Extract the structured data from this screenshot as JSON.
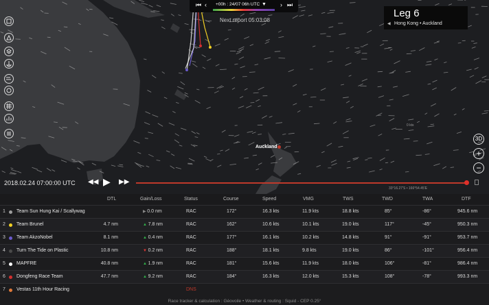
{
  "topbar": {
    "timestamp": "+00h : 24/07 06h UTC"
  },
  "next_report": "Next report 05:03:08",
  "leg": {
    "title": "Leg 6",
    "route": "Hong Kong • Auckland"
  },
  "map": {
    "city_label": "Auckland",
    "speed_readout": "0 kts",
    "coords_readout": "33°16.27'S • 166°54.45'E"
  },
  "right_controls": {
    "view3d": "3D",
    "zoom_in": "+",
    "zoom_out": "−"
  },
  "playback": {
    "date": "2018.02.24 07:00:00 UTC"
  },
  "colors": {
    "timeline": "#c0392b",
    "gain": "#32b04a",
    "loss": "#e53935"
  },
  "table": {
    "headers": {
      "dtl": "DTL",
      "gainloss": "Gain/Loss",
      "status": "Status",
      "course": "Course",
      "speed": "Speed",
      "vmg": "VMG",
      "tws": "TWS",
      "twd": "TWD",
      "twa": "TWA",
      "dtf": "DTF"
    },
    "rows": [
      {
        "rank": "1",
        "team": "Team Sun Hung Kai / Scallywag",
        "color": "#9e9e9e",
        "dtl": "",
        "gain_dir": "flat",
        "gain": "0.0 nm",
        "status": "RAC",
        "course": "172°",
        "speed": "16.3 kts",
        "vmg": "11.9 kts",
        "tws": "18.8 kts",
        "twd": "85°",
        "twa": "-86°",
        "dtf": "945.6 nm"
      },
      {
        "rank": "2",
        "team": "Team Brunel",
        "color": "#f2d024",
        "dtl": "4.7 nm",
        "gain_dir": "up",
        "gain": "7.8 nm",
        "status": "RAC",
        "course": "162°",
        "speed": "10.6 kts",
        "vmg": "10.1 kts",
        "tws": "19.0 kts",
        "twd": "117°",
        "twa": "-45°",
        "dtf": "950.3 nm"
      },
      {
        "rank": "3",
        "team": "Team AkzoNobel",
        "color": "#6a5acd",
        "dtl": "8.1 nm",
        "gain_dir": "up",
        "gain": "0.4 nm",
        "status": "RAC",
        "course": "177°",
        "speed": "16.1 kts",
        "vmg": "10.2 kts",
        "tws": "14.8 kts",
        "twd": "91°",
        "twa": "-91°",
        "dtf": "953.7 nm"
      },
      {
        "rank": "4",
        "team": "Turn The Tide on Plastic",
        "color": "#4a4a4a",
        "dtl": "10.8 nm",
        "gain_dir": "down",
        "gain": "0.2 nm",
        "status": "RAC",
        "course": "188°",
        "speed": "18.1 kts",
        "vmg": "9.8 kts",
        "tws": "19.0 kts",
        "twd": "86°",
        "twa": "-101°",
        "dtf": "956.4 nm"
      },
      {
        "rank": "5",
        "team": "MAPFRE",
        "color": "#ffffff",
        "dtl": "40.8 nm",
        "gain_dir": "up",
        "gain": "1.9 nm",
        "status": "RAC",
        "course": "181°",
        "speed": "15.6 kts",
        "vmg": "11.9 kts",
        "tws": "18.0 kts",
        "twd": "106°",
        "twa": "-81°",
        "dtf": "986.4 nm"
      },
      {
        "rank": "6",
        "team": "Dongfeng Race Team",
        "color": "#d32f2f",
        "dtl": "47.7 nm",
        "gain_dir": "up",
        "gain": "9.2 nm",
        "status": "RAC",
        "course": "184°",
        "speed": "16.3 kts",
        "vmg": "12.0 kts",
        "tws": "15.3 kts",
        "twd": "108°",
        "twa": "-78°",
        "dtf": "993.3 nm"
      },
      {
        "rank": "7",
        "team": "Vestas 11th Hour Racing",
        "color": "#e0793a",
        "dtl": "",
        "gain_dir": "",
        "gain": "",
        "status": "DNS",
        "course": "",
        "speed": "",
        "vmg": "",
        "tws": "",
        "twd": "",
        "twa": "",
        "dtf": ""
      }
    ]
  },
  "footer": "Race tracker & calculation : Géovoile • Weather & routing : Squid - CEP 0.25°"
}
